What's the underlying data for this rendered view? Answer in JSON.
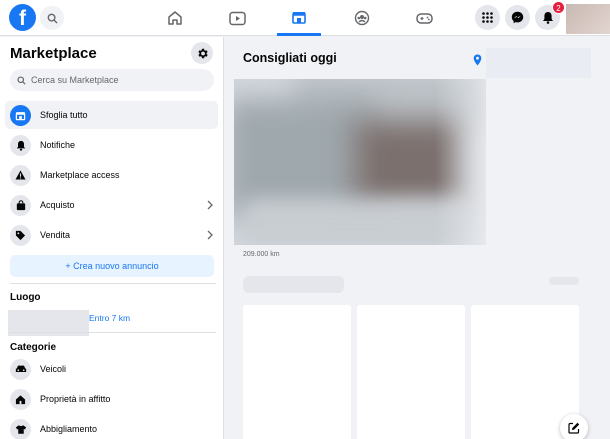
{
  "topbar": {
    "logo": "f",
    "notification_count": "2",
    "nav": [
      {
        "name": "home-icon"
      },
      {
        "name": "video-icon"
      },
      {
        "name": "marketplace-icon",
        "active": true
      },
      {
        "name": "groups-icon"
      },
      {
        "name": "gaming-icon"
      }
    ]
  },
  "sidebar": {
    "title": "Marketplace",
    "search_placeholder": "Cerca su Marketplace",
    "items": [
      {
        "label": "Sfoglia tutto",
        "icon": "storefront-icon",
        "active": true
      },
      {
        "label": "Notifiche",
        "icon": "bell-icon"
      },
      {
        "label": "Marketplace access",
        "icon": "warning-icon"
      },
      {
        "label": "Acquisto",
        "icon": "shopping-bag-icon",
        "chevron": true
      },
      {
        "label": "Vendita",
        "icon": "price-tag-icon",
        "chevron": true
      }
    ],
    "create_button": "+ Crea nuovo annuncio",
    "location_title": "Luogo",
    "location_range": "Entro 7 km",
    "categories_title": "Categorie",
    "categories": [
      {
        "label": "Veicoli",
        "icon": "car-icon"
      },
      {
        "label": "Proprietà in affitto",
        "icon": "house-icon"
      },
      {
        "label": "Abbigliamento",
        "icon": "shirt-icon"
      }
    ]
  },
  "main": {
    "title": "Consigliati oggi",
    "listing_price": "209.000 km"
  },
  "colors": {
    "accent": "#1877f2",
    "badge": "#e41e3f",
    "background": "#f0f2f5"
  }
}
